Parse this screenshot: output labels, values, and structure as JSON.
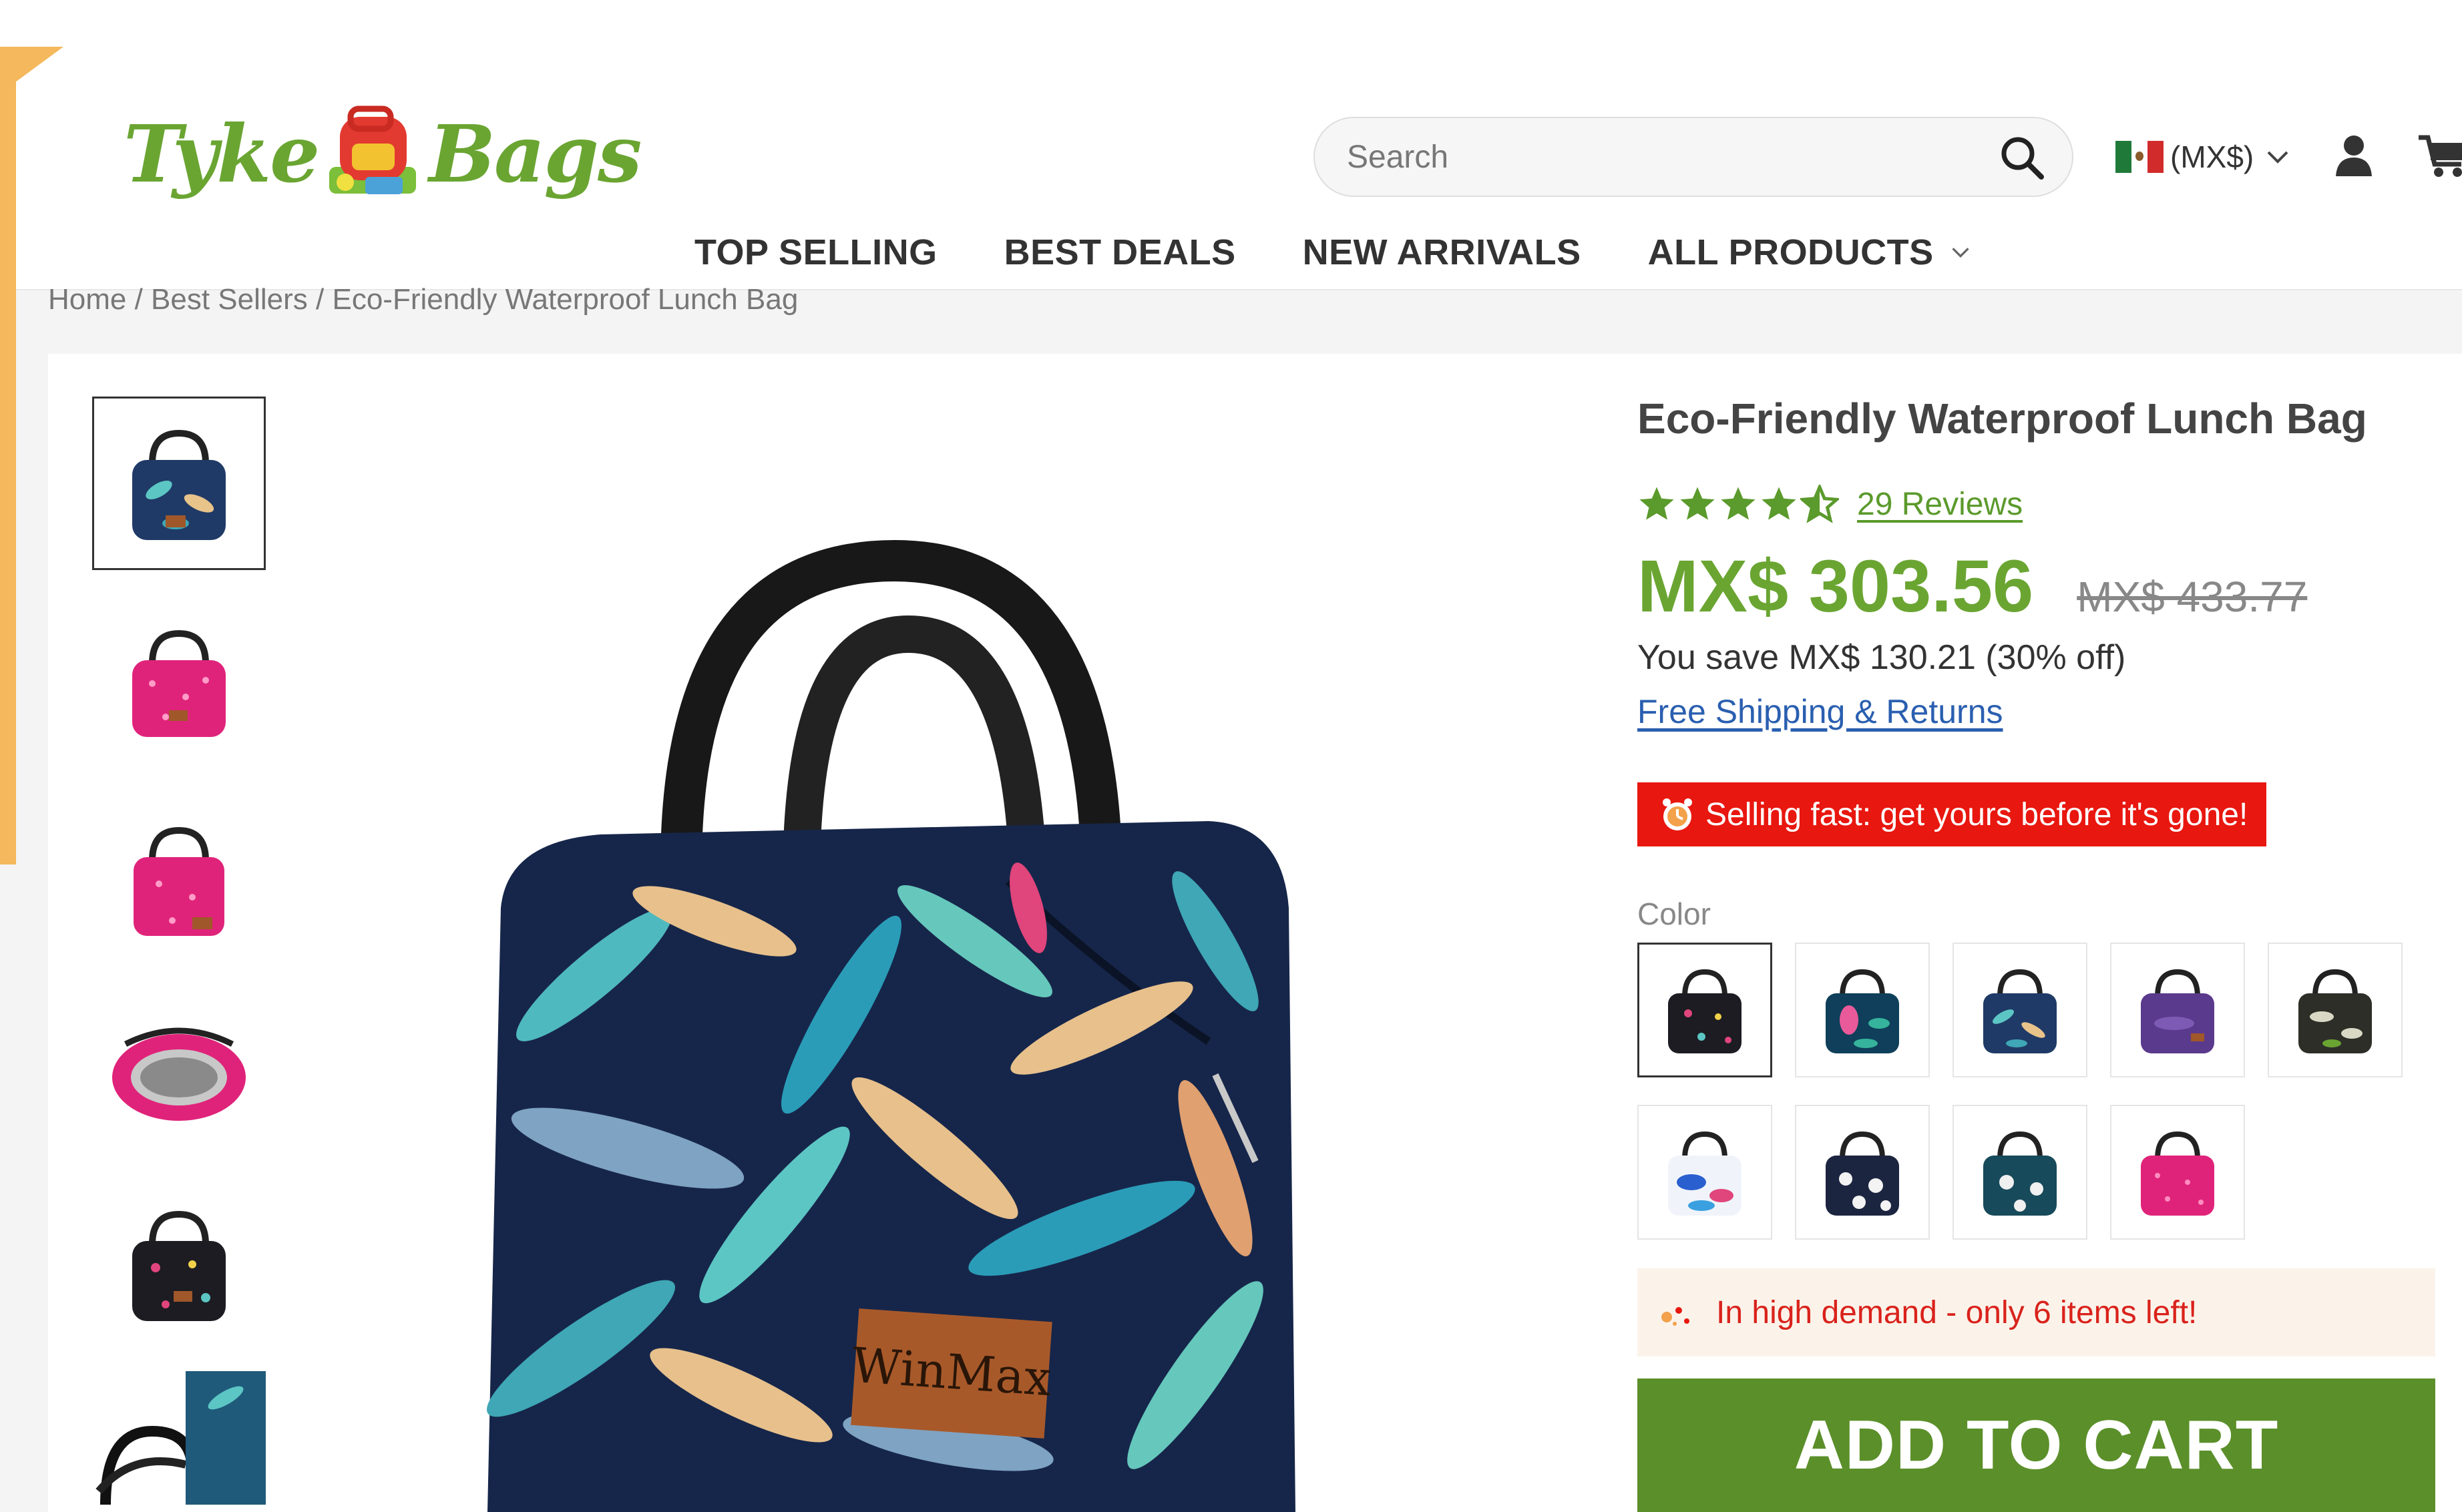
{
  "header": {
    "logo_left": "Tyke",
    "logo_right": "Bags",
    "search": {
      "placeholder": "Search"
    },
    "currency": "(MX$)",
    "nav": [
      {
        "label": "TOP SELLING"
      },
      {
        "label": "BEST DEALS"
      },
      {
        "label": "NEW ARRIVALS"
      },
      {
        "label": "ALL PRODUCTS"
      }
    ]
  },
  "breadcrumb": "Home / Best Sellers / Eco-Friendly Waterproof Lunch Bag",
  "product": {
    "title": "Eco-Friendly Waterproof Lunch Bag",
    "rating": 4.5,
    "reviews_label": "29 Reviews",
    "price": "MX$ 303.56",
    "old_price": "MX$ 433.77",
    "savings": "You save MX$ 130.21 (30% off)",
    "shipping_link": "Free Shipping & Returns",
    "urgency_banner": "Selling fast: get yours before it's gone!",
    "color_label": "Color",
    "colors": [
      {
        "name": "black-floral",
        "bg": "#1c1c22",
        "accent": "#e0457b"
      },
      {
        "name": "navy-flamingo",
        "bg": "#0f3f5a",
        "accent": "#e85a9a"
      },
      {
        "name": "blue-leaves",
        "bg": "#1f3a66",
        "accent": "#5cc6c4"
      },
      {
        "name": "purple",
        "bg": "#5a3a8c",
        "accent": "#7d5bb5"
      },
      {
        "name": "dark-tropical",
        "bg": "#2e2e28",
        "accent": "#d8d8c4"
      },
      {
        "name": "white-blue-abstract",
        "bg": "#f0f4fa",
        "accent": "#2a5fcf"
      },
      {
        "name": "navy-white-floral",
        "bg": "#1c2540",
        "accent": "#f3f3f3"
      },
      {
        "name": "teal-white-floral",
        "bg": "#174a5a",
        "accent": "#f0f0f0"
      },
      {
        "name": "pink-dots",
        "bg": "#e0237a",
        "accent": "#ff8cc0"
      }
    ],
    "demand_text": "In high demand - only 6 items left!",
    "add_to_cart": "ADD TO CART",
    "brand_patch": "WinMax"
  },
  "colors": {
    "brand_green": "#6aa532",
    "cart_green": "#5b8f2a",
    "alert_red": "#e8170f",
    "link_blue": "#2a5fb0",
    "orange_accent": "#f5b85c"
  }
}
